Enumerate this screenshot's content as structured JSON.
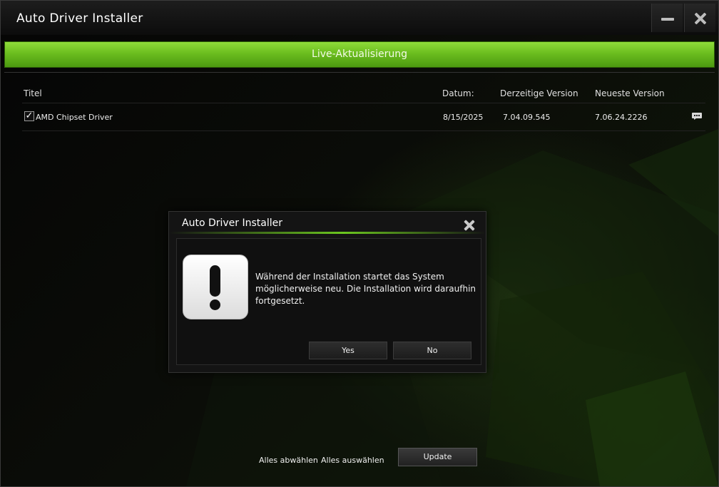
{
  "window": {
    "title": "Auto Driver Installer",
    "minimize_icon": "minimize-icon",
    "close_icon": "close-icon"
  },
  "live_update_label": "Live-Aktualisierung",
  "table": {
    "headers": {
      "title": "Titel",
      "date": "Datum:",
      "current_version": "Derzeitige Version",
      "latest_version": "Neueste Version"
    },
    "rows": [
      {
        "checked": true,
        "title": "AMD Chipset Driver",
        "date": "8/15/2025",
        "current_version": "7.04.09.545",
        "latest_version": "7.06.24.2226",
        "icon": "comment-icon"
      }
    ]
  },
  "dialog": {
    "title": "Auto Driver Installer",
    "icon": "exclamation-icon",
    "message": "Während der Installation startet das System möglicherweise neu. Die Installation wird daraufhin fortgesetzt.",
    "yes_label": "Yes",
    "no_label": "No"
  },
  "footer": {
    "deselect_all_label": "Alles abwählen",
    "select_all_label": "Alles auswählen",
    "update_label": "Update"
  },
  "colors": {
    "accent_green": "#6bbd1f",
    "background": "#000000"
  }
}
